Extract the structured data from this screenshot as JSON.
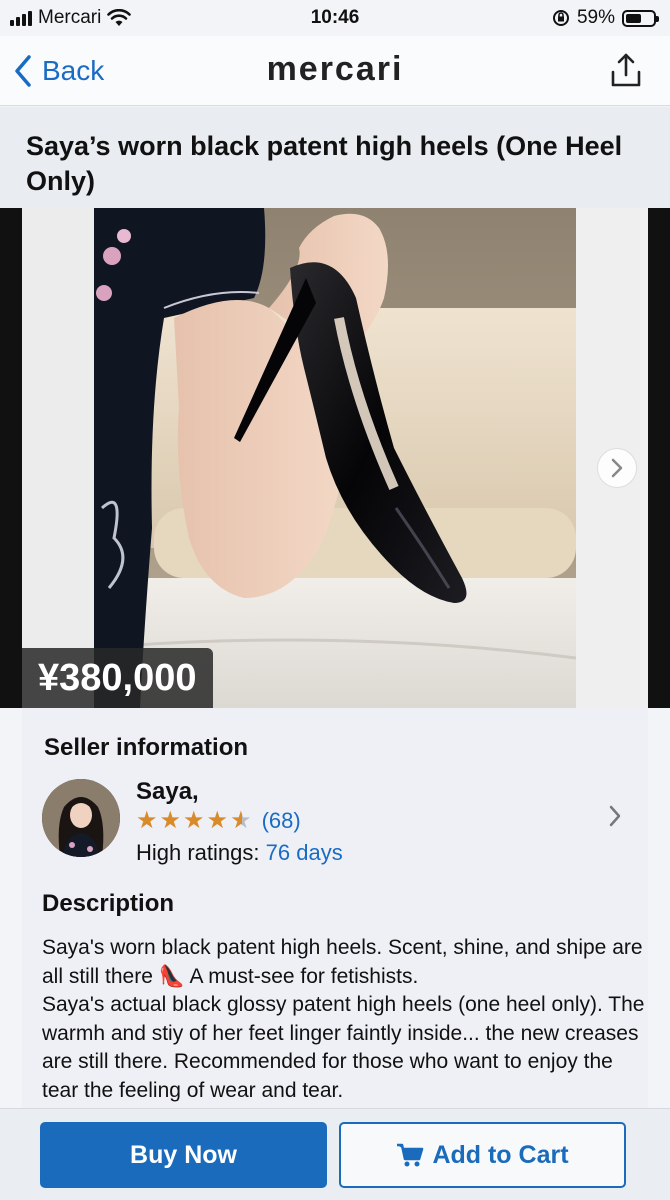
{
  "status_bar": {
    "carrier": "Mercari",
    "time": "10:46",
    "battery_text": "59%",
    "battery_level": 0.59
  },
  "nav": {
    "back_label": "Back",
    "logo": "mercari",
    "share_icon": "share-icon"
  },
  "product": {
    "title": "Saya’s worn black patent high heels (One Heel Only)",
    "price": "¥380,000"
  },
  "seller": {
    "section_title": "Seller information",
    "name": "Saya,",
    "rating": 4.5,
    "rating_count": "(68)",
    "high_ratings_label": "High ratings:",
    "high_ratings_value": "76 days"
  },
  "description": {
    "section_title": "Description",
    "text_1": "Saya's worn black patent high heels. Scent, shine, and shipe are all still there 👠 A must-see for fetishists.",
    "text_2": "Saya's actual black glossy patent high heels (one heel only). The warmh and stiy of her feet linger faintly inside... the new creases are still there. Recommended for those who want to enjoy the tear the feeling of wear and tear."
  },
  "actions": {
    "buy_label": "Buy Now",
    "cart_label": "Add to Cart"
  },
  "colors": {
    "accent": "#1a6bbc",
    "star": "#d98a2b"
  }
}
